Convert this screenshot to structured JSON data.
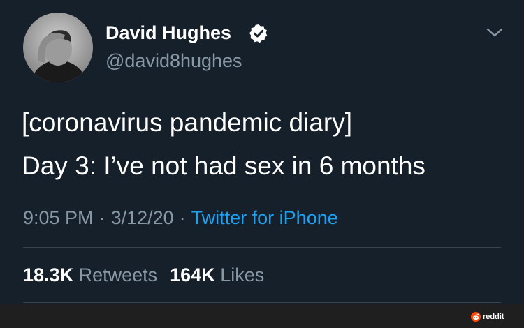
{
  "author": {
    "display_name": "David Hughes",
    "handle": "@david8hughes",
    "verified": true
  },
  "tweet": {
    "lines": [
      "[coronavirus pandemic diary]",
      "Day 3: I’ve not had sex in 6 months"
    ],
    "time": "9:05 PM",
    "date": "3/12/20",
    "separator": "·",
    "source": "Twitter for iPhone"
  },
  "stats": {
    "retweets_count": "18.3K",
    "retweets_label": "Retweets",
    "likes_count": "164K",
    "likes_label": "Likes"
  },
  "watermark": {
    "text": "reddit"
  },
  "colors": {
    "background": "#15202b",
    "secondary_text": "#8899a6",
    "link": "#1da1f2",
    "verified_badge": "#ffffff",
    "reddit": "#ff4500"
  },
  "icons": {
    "verified": "verified-badge-icon",
    "menu": "chevron-down-icon",
    "reddit": "reddit-logo-icon"
  }
}
